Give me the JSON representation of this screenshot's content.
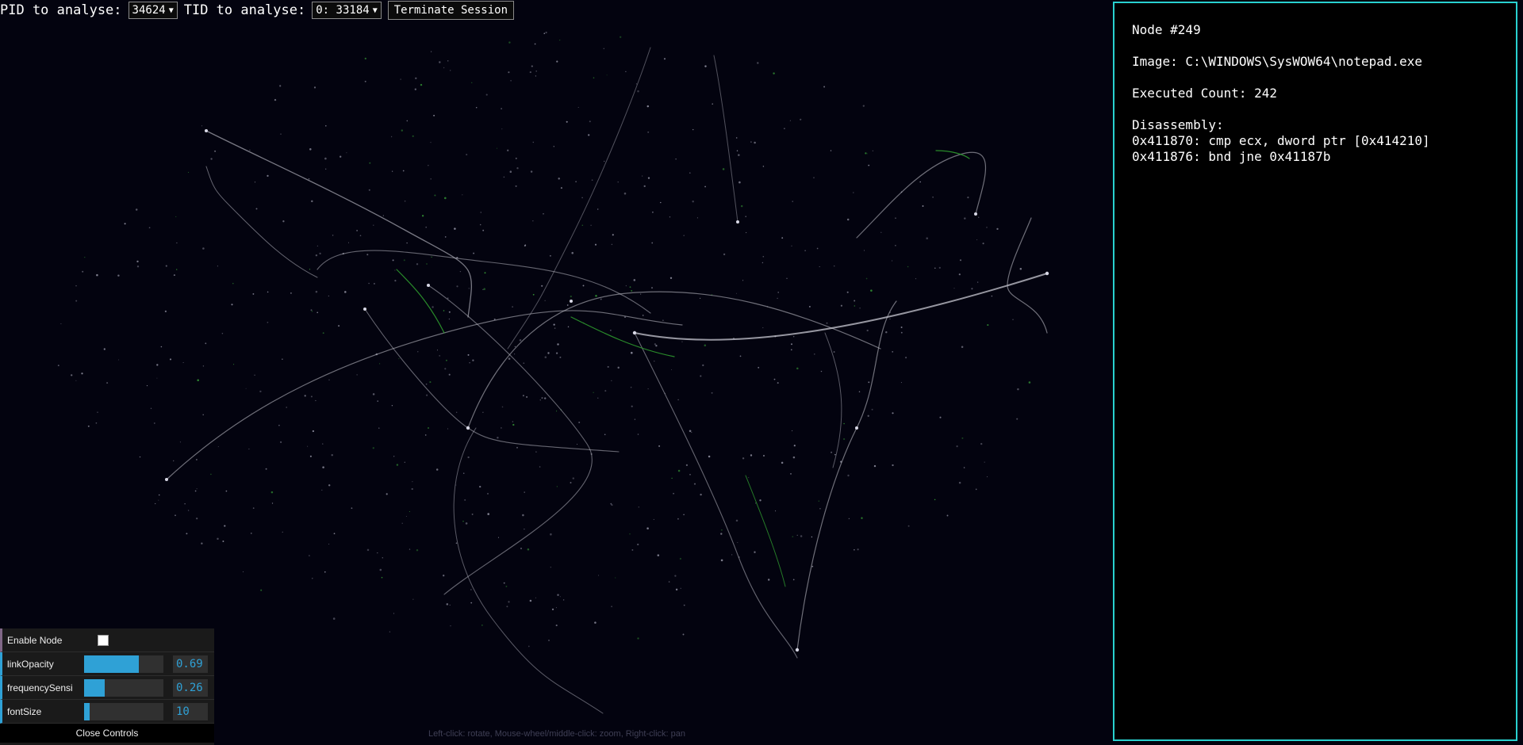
{
  "topbar": {
    "pid_label": "PID to analyse:",
    "pid_value": "34624",
    "tid_label": "TID to analyse:",
    "tid_value": "0: 33184",
    "terminate_label": "Terminate Session"
  },
  "node_info": {
    "title": "Node #249",
    "image": "Image: C:\\WINDOWS\\SysWOW64\\notepad.exe",
    "executed_count": "Executed Count: 242",
    "disassembly_label": "Disassembly:",
    "instructions": [
      "0x411870: cmp ecx, dword ptr [0x414210]",
      "0x411876: bnd jne 0x41187b"
    ]
  },
  "controls": {
    "enable_node_label": "Enable Node",
    "enable_node_checked": false,
    "link_opacity_label": "linkOpacity",
    "link_opacity_value": "0.69",
    "link_opacity_level": 0.69,
    "frequency_label": "frequencySensi",
    "frequency_value": "0.26",
    "frequency_level": 0.26,
    "font_size_label": "fontSize",
    "font_size_value": "10",
    "font_size_level": 0.07,
    "close_label": "Close Controls"
  },
  "hint": "Left-click: rotate, Mouse-wheel/middle-click: zoom, Right-click: pan",
  "colors": {
    "background": "#03030f",
    "panel_border": "#29d1cf",
    "slider_accent": "#2fa1d6",
    "link": "#c8c8d2",
    "link_highlight": "#2e9a2e"
  }
}
